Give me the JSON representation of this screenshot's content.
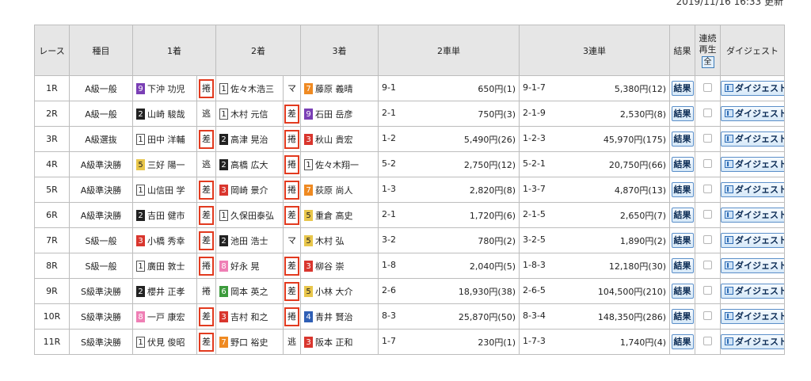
{
  "update_text": "2019/11/16 16:33 更新",
  "headers": {
    "race": "レース",
    "class": "種目",
    "first": "1着",
    "second": "2着",
    "third": "3着",
    "exacta": "2車単",
    "trifecta": "3連単",
    "result": "結果",
    "replay_line1": "連続",
    "replay_line2": "再生",
    "replay_all": "全",
    "digest": "ダイジェスト"
  },
  "labels": {
    "result_button": "結果",
    "digest_button": "ダイジェスト"
  },
  "colors": {
    "highlight_box": "#e23a1f",
    "frame1": "#ffffff",
    "frame2": "#222222",
    "frame3": "#d9362e",
    "frame4": "#2f5fb5",
    "frame5": "#e8c64b",
    "frame6": "#3c9b3c",
    "frame7": "#ef8a22",
    "frame8": "#ef7fb5",
    "frame9": "#7a3fb5"
  },
  "rows": [
    {
      "race": "1R",
      "class": "A級一般",
      "p1": {
        "num": "9",
        "frame": 9,
        "name": "下沖 功児"
      },
      "k1": "捲",
      "p2": {
        "num": "1",
        "frame": 1,
        "name": "佐々木浩三"
      },
      "k2": "マ",
      "p3": {
        "num": "7",
        "frame": 7,
        "name": "藤原 義晴"
      },
      "ex_combo": "9-1",
      "ex_amount": "650円",
      "ex_pop": "(1)",
      "tri_combo": "9-1-7",
      "tri_amount": "5,380円",
      "tri_pop": "(12)"
    },
    {
      "race": "2R",
      "class": "A級一般",
      "p1": {
        "num": "2",
        "frame": 2,
        "name": "山崎 駿哉"
      },
      "k1": "逃",
      "p2": {
        "num": "1",
        "frame": 1,
        "name": "木村 元信"
      },
      "k2": "差",
      "p3": {
        "num": "9",
        "frame": 9,
        "name": "石田 岳彦"
      },
      "ex_combo": "2-1",
      "ex_amount": "750円",
      "ex_pop": "(3)",
      "tri_combo": "2-1-9",
      "tri_amount": "2,530円",
      "tri_pop": "(8)"
    },
    {
      "race": "3R",
      "class": "A級選抜",
      "p1": {
        "num": "1",
        "frame": 1,
        "name": "田中 洋輔"
      },
      "k1": "差",
      "p2": {
        "num": "2",
        "frame": 2,
        "name": "高津 晃治"
      },
      "k2": "捲",
      "p3": {
        "num": "3",
        "frame": 3,
        "name": "秋山 貴宏"
      },
      "ex_combo": "1-2",
      "ex_amount": "5,490円",
      "ex_pop": "(26)",
      "tri_combo": "1-2-3",
      "tri_amount": "45,970円",
      "tri_pop": "(175)"
    },
    {
      "race": "4R",
      "class": "A級準決勝",
      "p1": {
        "num": "5",
        "frame": 5,
        "name": "三好 陽一"
      },
      "k1": "逃",
      "p2": {
        "num": "2",
        "frame": 2,
        "name": "高橋 広大"
      },
      "k2": "捲",
      "p3": {
        "num": "1",
        "frame": 1,
        "name": "佐々木翔一"
      },
      "ex_combo": "5-2",
      "ex_amount": "2,750円",
      "ex_pop": "(12)",
      "tri_combo": "5-2-1",
      "tri_amount": "20,750円",
      "tri_pop": "(66)"
    },
    {
      "race": "5R",
      "class": "A級準決勝",
      "p1": {
        "num": "1",
        "frame": 1,
        "name": "山信田 学"
      },
      "k1": "差",
      "p2": {
        "num": "3",
        "frame": 3,
        "name": "岡崎 景介"
      },
      "k2": "捲",
      "p3": {
        "num": "7",
        "frame": 7,
        "name": "荻原 尚人"
      },
      "ex_combo": "1-3",
      "ex_amount": "2,820円",
      "ex_pop": "(8)",
      "tri_combo": "1-3-7",
      "tri_amount": "4,870円",
      "tri_pop": "(13)"
    },
    {
      "race": "6R",
      "class": "A級準決勝",
      "p1": {
        "num": "2",
        "frame": 2,
        "name": "吉田 健市"
      },
      "k1": "差",
      "p2": {
        "num": "1",
        "frame": 1,
        "name": "久保田泰弘"
      },
      "k2": "差",
      "p3": {
        "num": "5",
        "frame": 5,
        "name": "重倉 高史"
      },
      "ex_combo": "2-1",
      "ex_amount": "1,720円",
      "ex_pop": "(6)",
      "tri_combo": "2-1-5",
      "tri_amount": "2,650円",
      "tri_pop": "(7)"
    },
    {
      "race": "7R",
      "class": "S級一般",
      "p1": {
        "num": "3",
        "frame": 3,
        "name": "小橋 秀幸"
      },
      "k1": "差",
      "p2": {
        "num": "2",
        "frame": 2,
        "name": "池田 浩士"
      },
      "k2": "マ",
      "p3": {
        "num": "5",
        "frame": 5,
        "name": "木村 弘"
      },
      "ex_combo": "3-2",
      "ex_amount": "780円",
      "ex_pop": "(2)",
      "tri_combo": "3-2-5",
      "tri_amount": "1,890円",
      "tri_pop": "(2)"
    },
    {
      "race": "8R",
      "class": "S級一般",
      "p1": {
        "num": "1",
        "frame": 1,
        "name": "廣田 敦士"
      },
      "k1": "捲",
      "p2": {
        "num": "8",
        "frame": 8,
        "name": "好永 晃"
      },
      "k2": "差",
      "p3": {
        "num": "3",
        "frame": 3,
        "name": "柳谷 崇"
      },
      "ex_combo": "1-8",
      "ex_amount": "2,040円",
      "ex_pop": "(5)",
      "tri_combo": "1-8-3",
      "tri_amount": "12,180円",
      "tri_pop": "(30)"
    },
    {
      "race": "9R",
      "class": "S級準決勝",
      "p1": {
        "num": "2",
        "frame": 2,
        "name": "櫻井 正孝"
      },
      "k1": "捲",
      "p2": {
        "num": "6",
        "frame": 6,
        "name": "岡本 英之"
      },
      "k2": "差",
      "p3": {
        "num": "5",
        "frame": 5,
        "name": "小林 大介"
      },
      "ex_combo": "2-6",
      "ex_amount": "18,930円",
      "ex_pop": "(38)",
      "tri_combo": "2-6-5",
      "tri_amount": "104,500円",
      "tri_pop": "(210)"
    },
    {
      "race": "10R",
      "class": "S級準決勝",
      "p1": {
        "num": "8",
        "frame": 8,
        "name": "一戸 康宏"
      },
      "k1": "差",
      "p2": {
        "num": "3",
        "frame": 3,
        "name": "吉村 和之"
      },
      "k2": "捲",
      "p3": {
        "num": "4",
        "frame": 4,
        "name": "青井 賢治"
      },
      "ex_combo": "8-3",
      "ex_amount": "25,870円",
      "ex_pop": "(50)",
      "tri_combo": "8-3-4",
      "tri_amount": "148,350円",
      "tri_pop": "(286)"
    },
    {
      "race": "11R",
      "class": "S級準決勝",
      "p1": {
        "num": "1",
        "frame": 1,
        "name": "伏見 俊昭"
      },
      "k1": "差",
      "p2": {
        "num": "7",
        "frame": 7,
        "name": "野口 裕史"
      },
      "k2": "逃",
      "p3": {
        "num": "3",
        "frame": 3,
        "name": "阪本 正和"
      },
      "ex_combo": "1-7",
      "ex_amount": "230円",
      "ex_pop": "(1)",
      "tri_combo": "1-7-3",
      "tri_amount": "1,740円",
      "tri_pop": "(4)"
    }
  ]
}
